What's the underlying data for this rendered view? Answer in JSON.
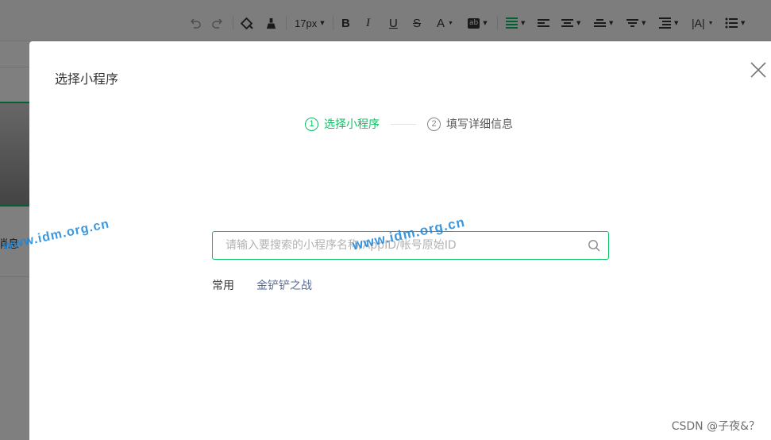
{
  "toolbar": {
    "font_size": "17px",
    "icons": [
      "undo-icon",
      "redo-icon",
      "format-painter-icon",
      "clear-format-icon",
      "bold-icon",
      "italic-icon",
      "underline-icon",
      "strikethrough-icon",
      "font-color-icon",
      "background-color-icon",
      "align-justify-icon",
      "align-left-icon",
      "align-center-icon",
      "vertical-align-icon",
      "line-height-icon",
      "indent-icon",
      "letter-spacing-icon",
      "list-icon"
    ],
    "bold": "B",
    "italic": "I",
    "underline": "U",
    "strike": "S",
    "font_color": "A",
    "bg_color": "ab",
    "letter_spacing": "|A|"
  },
  "background": {
    "left_text": "消息"
  },
  "dialog": {
    "title": "选择小程序",
    "steps": [
      {
        "num": "1",
        "label": "选择小程序",
        "active": true
      },
      {
        "num": "2",
        "label": "填写详细信息",
        "active": false
      }
    ],
    "search": {
      "placeholder": "请输入要搜索的小程序名称/AppID/帐号原始ID",
      "value": ""
    },
    "recent": {
      "label": "常用",
      "items": [
        "金铲铲之战"
      ]
    }
  },
  "watermarks": [
    "www.idm.org.cn",
    "www.idm.org.cn"
  ],
  "credit": "CSDN @子夜&？",
  "colors": {
    "accent": "#07c160",
    "link": "#576b95",
    "watermark": "#1a86d9"
  }
}
